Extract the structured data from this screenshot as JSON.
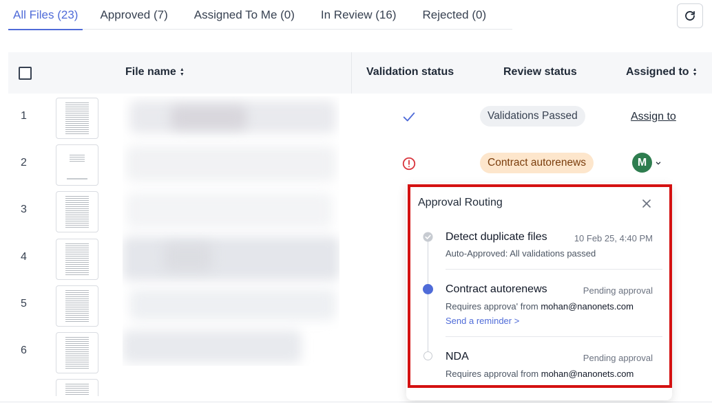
{
  "tabs": [
    {
      "label": "All Files (23)",
      "active": true
    },
    {
      "label": "Approved (7)",
      "active": false
    },
    {
      "label": "Assigned To Me (0)",
      "active": false
    },
    {
      "label": "In Review (16)",
      "active": false
    },
    {
      "label": "Rejected (0)",
      "active": false
    }
  ],
  "table": {
    "headers": {
      "file_name": "File name",
      "validation_status": "Validation status",
      "review_status": "Review status",
      "assigned_to": "Assigned to"
    },
    "rows": [
      {
        "num": "1",
        "validation": "check-icon",
        "review": "Validations Passed",
        "assigned": "Assign to"
      },
      {
        "num": "2",
        "validation": "alert-circle-icon",
        "review": "Contract autorenews",
        "assigned_avatar": "M"
      },
      {
        "num": "3"
      },
      {
        "num": "4"
      },
      {
        "num": "5"
      },
      {
        "num": "6"
      }
    ]
  },
  "popover": {
    "title": "Approval Routing",
    "steps": [
      {
        "title": "Detect duplicate files",
        "meta": "10 Feb 25, 4:40 PM",
        "sub": "Auto-Approved: All validations passed",
        "state": "done"
      },
      {
        "title": "Contract autorenews",
        "meta": "Pending approval",
        "sub_prefix": "Requires approva' from ",
        "sub_email": "mohan@nanonets.com",
        "link": "Send a reminder >",
        "state": "current"
      },
      {
        "title": "NDA",
        "meta": "Pending approval",
        "sub_prefix": "Requires approval from ",
        "sub_email": "mohan@nanonets.com",
        "state": "pending"
      }
    ]
  },
  "colors": {
    "accent": "#4f6bd8",
    "highlight_border": "#d41111",
    "pass_pill": "#eef0f3",
    "warn_pill": "#fde6cc",
    "avatar": "#2e7d4f",
    "alert": "#d9363e"
  }
}
